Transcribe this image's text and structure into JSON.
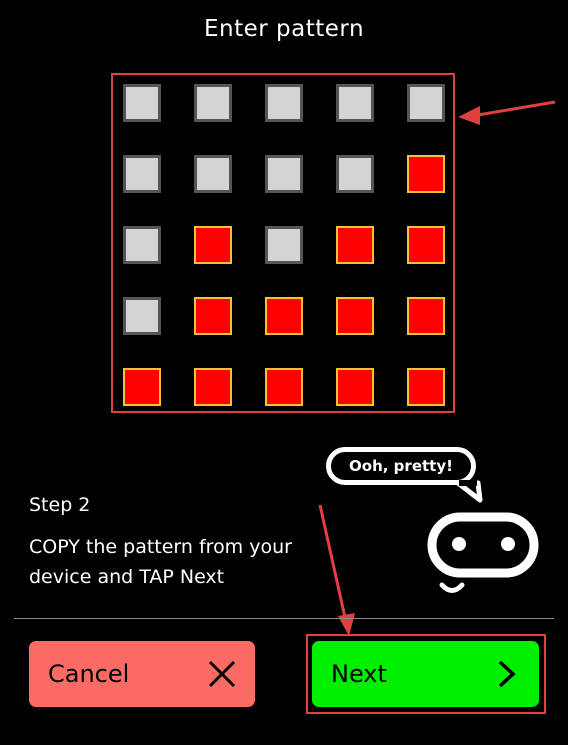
{
  "header": {
    "title": "Enter pattern"
  },
  "pattern": [
    [
      0,
      0,
      0,
      0,
      0
    ],
    [
      0,
      0,
      0,
      0,
      1
    ],
    [
      0,
      1,
      0,
      1,
      1
    ],
    [
      0,
      1,
      1,
      1,
      1
    ],
    [
      1,
      1,
      1,
      1,
      1
    ]
  ],
  "mascot": {
    "speech": "Ooh, pretty!"
  },
  "instructions": {
    "step": "Step 2",
    "line1": "COPY the pattern from your",
    "line2": "device and TAP Next"
  },
  "buttons": {
    "cancel_label": "Cancel",
    "next_label": "Next"
  },
  "colors": {
    "background": "#000000",
    "cell_on": "#ff0000",
    "cell_on_border": "#f4c430",
    "cell_off": "#d4d4d4",
    "cancel_bg": "#f96b63",
    "next_bg": "#00ee00",
    "annotation": "#e0403f"
  },
  "icons": {
    "cancel": "close-icon",
    "next": "chevron-right-icon"
  }
}
